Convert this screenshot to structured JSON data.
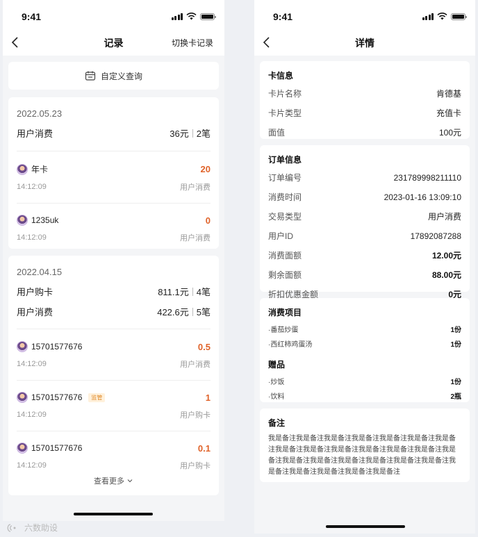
{
  "status_bar": {
    "time": "9:41"
  },
  "left": {
    "nav": {
      "title": "记录",
      "right_action": "切换卡记录"
    },
    "query_button": "自定义查询",
    "groups": [
      {
        "date": "2022.05.23",
        "summaries": [
          {
            "label": "用户消费",
            "amount": "36元",
            "count": "2笔"
          }
        ],
        "records": [
          {
            "name": "年卡",
            "amount": "20",
            "time": "14:12:09",
            "type": "用户消费",
            "tag": ""
          },
          {
            "name": "1235uk",
            "amount": "0",
            "time": "14:12:09",
            "type": "用户消费",
            "tag": ""
          }
        ]
      },
      {
        "date": "2022.04.15",
        "summaries": [
          {
            "label": "用户购卡",
            "amount": "811.1元",
            "count": "4笔"
          },
          {
            "label": "用户消费",
            "amount": "422.6元",
            "count": "5笔"
          }
        ],
        "records": [
          {
            "name": "15701577676",
            "amount": "0.5",
            "time": "14:12:09",
            "type": "用户消费",
            "tag": ""
          },
          {
            "name": "15701577676",
            "amount": "1",
            "time": "14:12:09",
            "type": "用户购卡",
            "tag": "监管"
          },
          {
            "name": "15701577676",
            "amount": "0.1",
            "time": "14:12:09",
            "type": "用户购卡",
            "tag": ""
          }
        ],
        "more": "查看更多"
      }
    ]
  },
  "right": {
    "nav": {
      "title": "详情"
    },
    "card_info": {
      "title": "卡信息",
      "rows": [
        {
          "label": "卡片名称",
          "value": "肯德基"
        },
        {
          "label": "卡片类型",
          "value": "充值卡"
        },
        {
          "label": "面值",
          "value": "100元"
        }
      ]
    },
    "order_info": {
      "title": "订单信息",
      "rows": [
        {
          "label": "订单编号",
          "value": "231789998211110"
        },
        {
          "label": "消费时间",
          "value": "2023-01-16 13:09:10"
        },
        {
          "label": "交易类型",
          "value": "用户消费"
        },
        {
          "label": "用户ID",
          "value": "17892087288"
        },
        {
          "label": "消费面额",
          "value": "12.00元"
        },
        {
          "label": "剩余面额",
          "value": "88.00元"
        },
        {
          "label": "折扣优惠金额",
          "value": "0元"
        }
      ]
    },
    "items": {
      "title": "消费项目",
      "list": [
        {
          "name": "·番茄炒蛋",
          "qty": "1份"
        },
        {
          "name": "·西红柿鸡蛋汤",
          "qty": "1份"
        }
      ],
      "gift_title": "赠品",
      "gifts": [
        {
          "name": "·炒饭",
          "qty": "1份"
        },
        {
          "name": "·饮料",
          "qty": "2瓶"
        }
      ]
    },
    "remark": {
      "title": "备注",
      "text": "我是备注我是备注我是备注我是备注我是备注我是备注我是备注我是备注我是备注我是备注我是备注我是备注我是备注我是备注我是备注我是备注我是备注我是备注我是备注我是备注我是备注我是备注我是备注我是备注我是备注"
    }
  },
  "watermark": "六数助设"
}
